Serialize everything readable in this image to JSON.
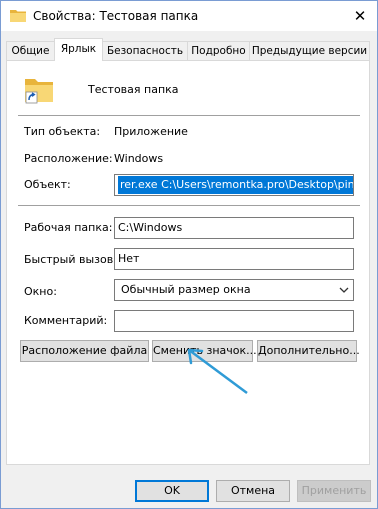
{
  "window": {
    "title": "Свойства: Тестовая папка",
    "close_glyph": "✕"
  },
  "tabs": [
    {
      "label": "Общие"
    },
    {
      "label": "Ярлык"
    },
    {
      "label": "Безопасность"
    },
    {
      "label": "Подробно"
    },
    {
      "label": "Предыдущие версии"
    }
  ],
  "header": {
    "name": "Тестовая папка"
  },
  "info": {
    "type_label": "Тип объекта:",
    "type_value": "Приложение",
    "location_label": "Расположение:",
    "location_value": "Windows"
  },
  "fields": {
    "target_label": "Объект:",
    "target_value": "rer.exe C:\\Users\\remontka.pro\\Desktop\\pin-folder",
    "workdir_label": "Рабочая папка:",
    "workdir_value": "C:\\Windows",
    "hotkey_label": "Быстрый вызов:",
    "hotkey_value": "Нет",
    "window_label": "Окно:",
    "window_value": "Обычный размер окна",
    "comment_label": "Комментарий:",
    "comment_value": ""
  },
  "buttons": {
    "file_location": "Расположение файла",
    "change_icon": "Сменить значок...",
    "advanced": "Дополнительно...",
    "ok": "OK",
    "cancel": "Отмена",
    "apply": "Применить"
  },
  "colors": {
    "selection": "#0078d7",
    "annotation_arrow": "#2f9bd6",
    "folder": "#f8d775"
  }
}
